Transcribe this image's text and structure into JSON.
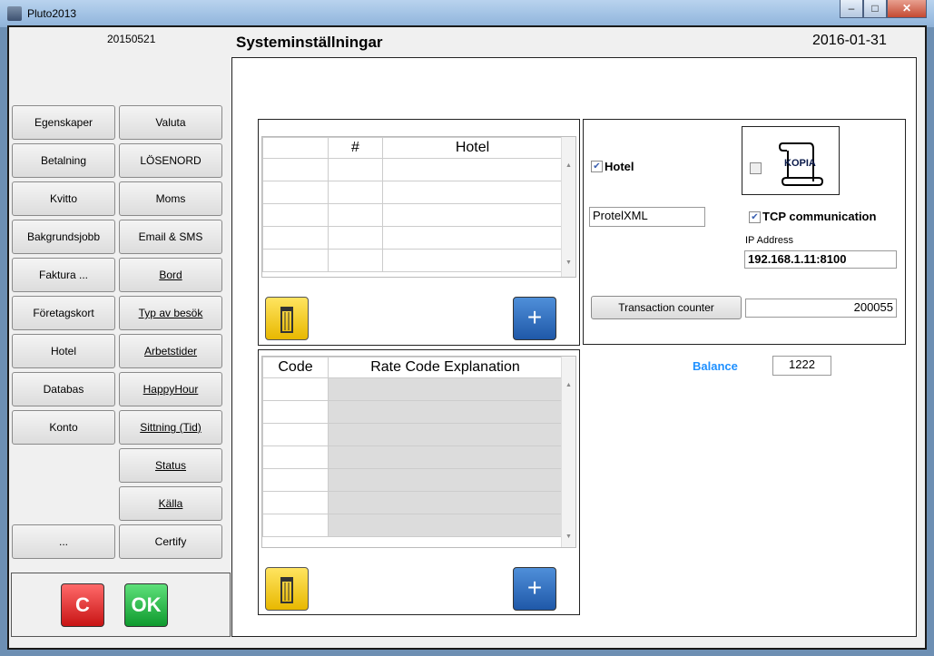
{
  "window": {
    "title": "Pluto2013",
    "min": "–",
    "max": "□",
    "close": "✕"
  },
  "left": {
    "version": "20150521",
    "col1": [
      "Egenskaper",
      "Betalning",
      "Kvitto",
      "Bakgrundsjobb",
      "Faktura ...",
      "Företagskort",
      "Hotel",
      "Databas",
      "Konto"
    ],
    "col2": [
      "Valuta",
      "LÖSENORD",
      "Moms",
      "Email & SMS",
      "Bord",
      "Typ av besök",
      "Arbetstider",
      "HappyHour",
      "Sittning (Tid)",
      "Status",
      "Källa",
      "Certify"
    ],
    "more": "...",
    "cancel": "C",
    "ok": "OK"
  },
  "header": {
    "title": "Systeminställningar",
    "date": "2016-01-31"
  },
  "hotel_table": {
    "columns": [
      "",
      "#",
      "Hotel"
    ],
    "rows": 5
  },
  "rate_table": {
    "columns": [
      "Code",
      "Rate Code Explanation"
    ],
    "rows": 7
  },
  "settings": {
    "hotel_label": "Hotel",
    "hotel_checked": true,
    "kopia_label": "KOPIA",
    "kopia_checked": false,
    "interface": "ProtelXML",
    "tcp_label": "TCP communication",
    "tcp_checked": true,
    "ip_label": "IP Address",
    "ip": "192.168.1.11:8100",
    "transaction_button": "Transaction counter",
    "transaction_value": "200055",
    "balance_label": "Balance",
    "balance_value": "1222",
    "balance_color": "#1e90ff"
  }
}
